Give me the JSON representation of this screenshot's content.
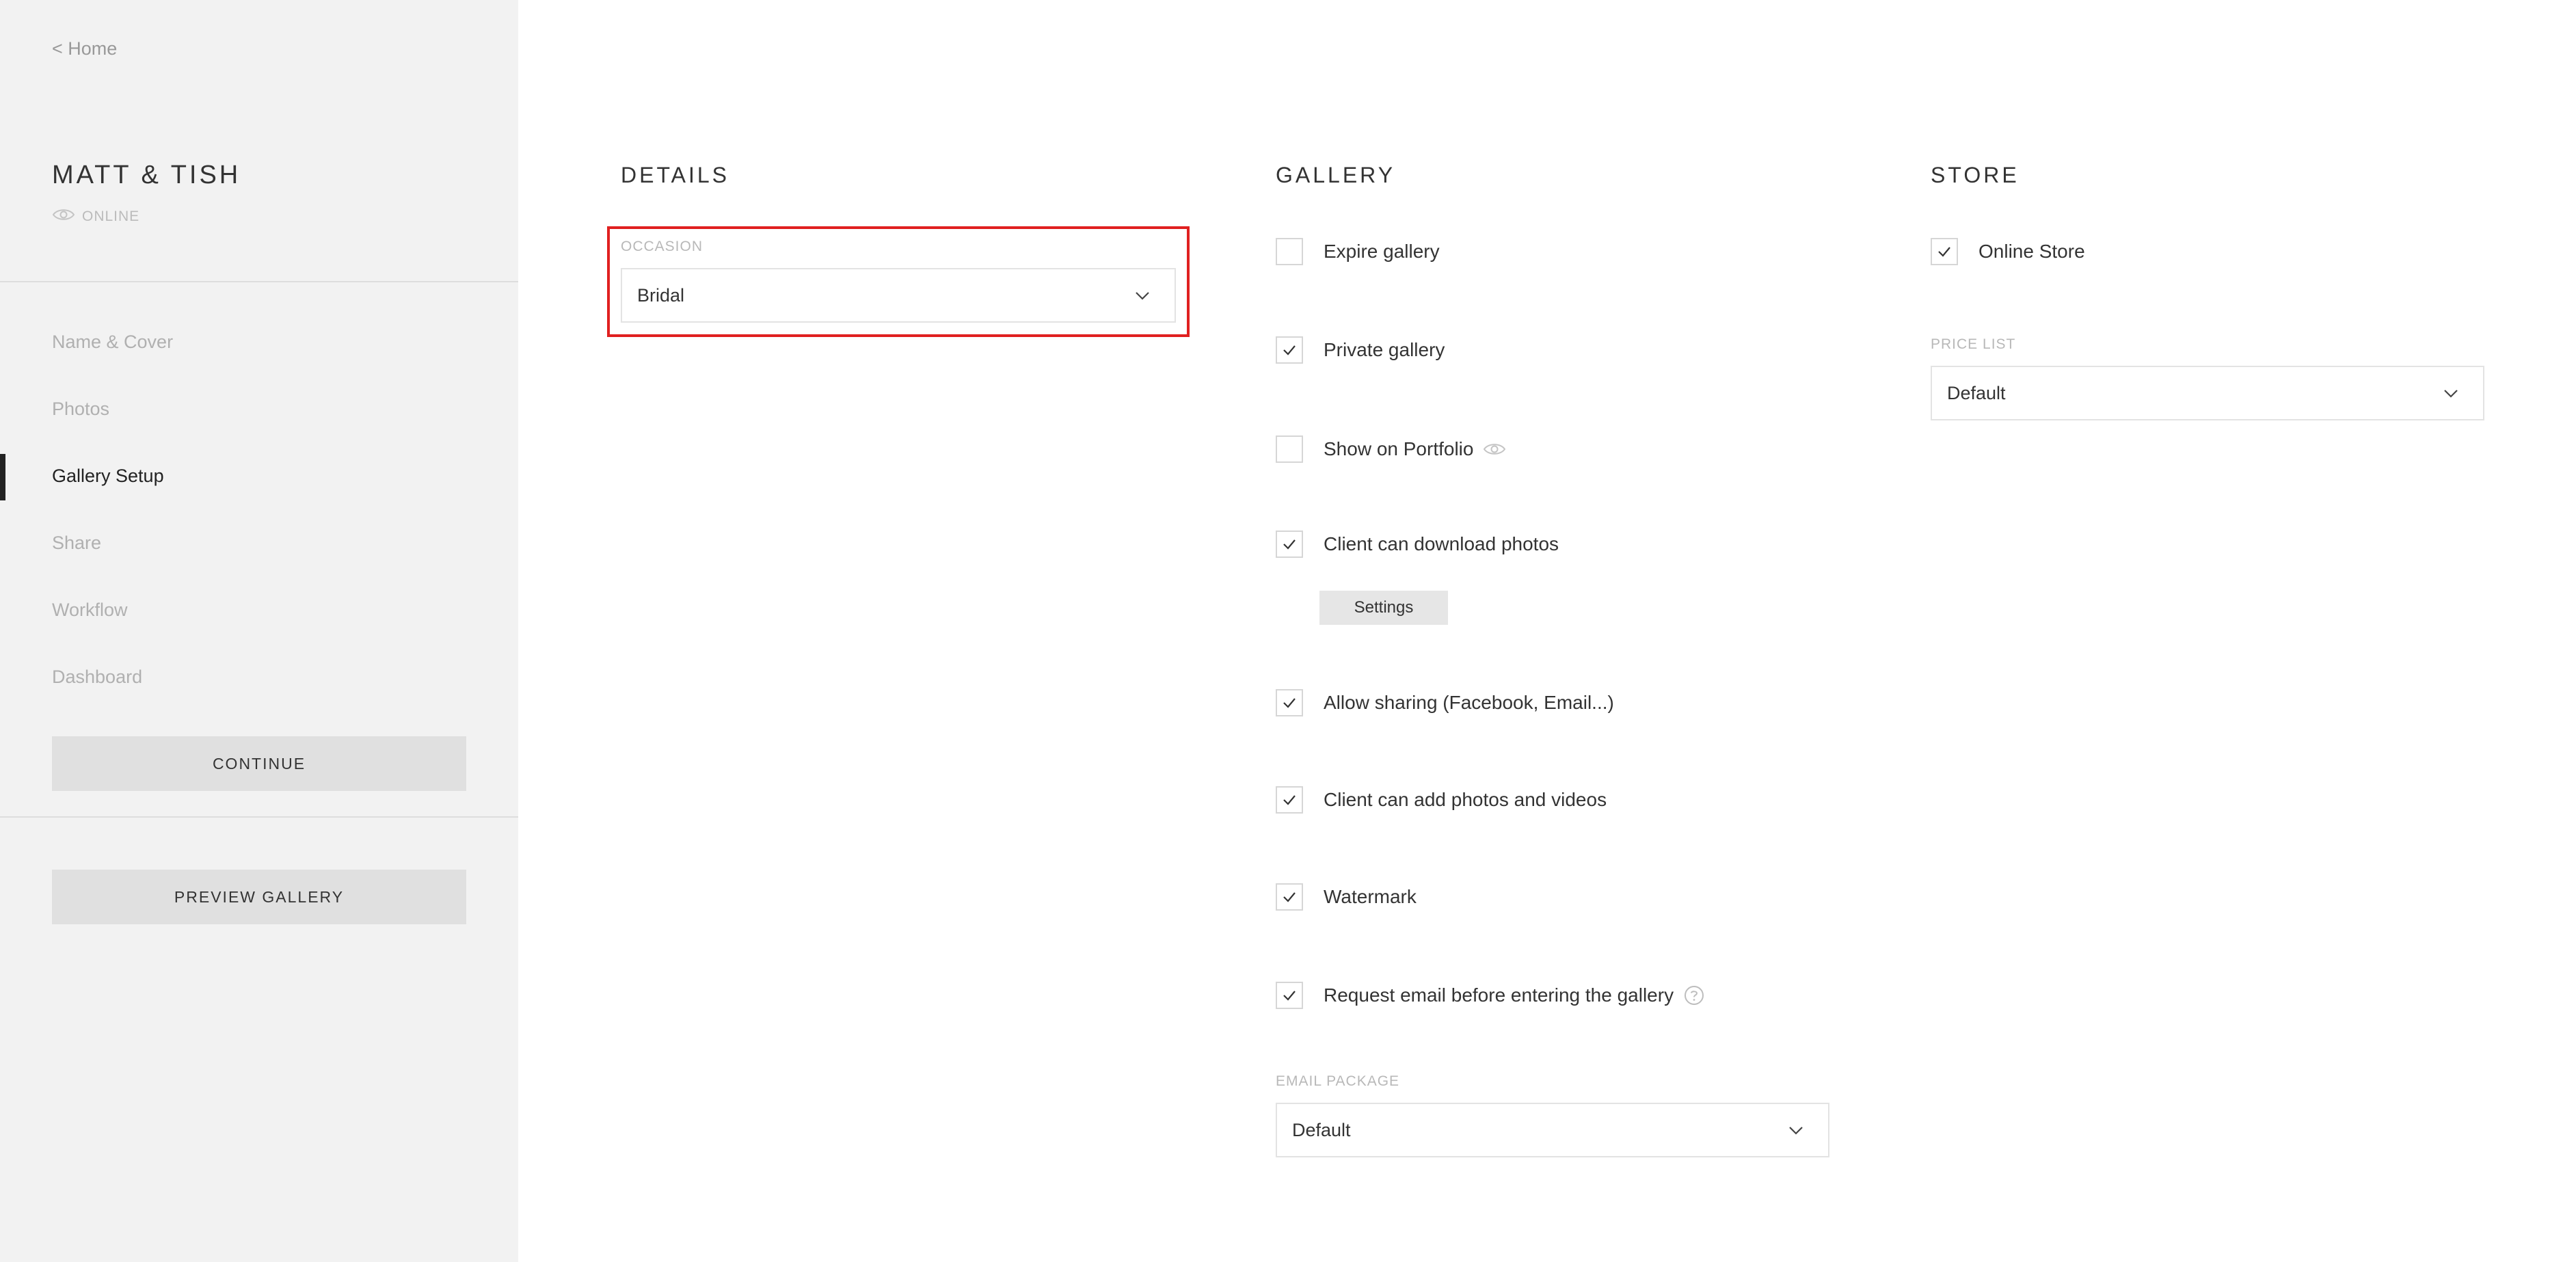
{
  "sidebar": {
    "home_link": "< Home",
    "gallery_title": "MATT & TISH",
    "status": "ONLINE",
    "nav": [
      "Name & Cover",
      "Photos",
      "Gallery Setup",
      "Share",
      "Workflow",
      "Dashboard"
    ],
    "active_nav": "Gallery Setup",
    "continue_label": "CONTINUE",
    "preview_label": "PREVIEW GALLERY"
  },
  "details": {
    "heading": "DETAILS",
    "occasion_label": "OCCASION",
    "occasion_value": "Bridal"
  },
  "gallery": {
    "heading": "GALLERY",
    "options": [
      {
        "label": "Expire gallery",
        "checked": false
      },
      {
        "label": "Private gallery",
        "checked": true
      },
      {
        "label": "Show on Portfolio",
        "checked": false,
        "icon": "eye-icon"
      },
      {
        "label": "Client can download photos",
        "checked": true
      },
      {
        "label": "Allow sharing (Facebook, Email...)",
        "checked": true
      },
      {
        "label": "Client can add photos and videos",
        "checked": true
      },
      {
        "label": "Watermark",
        "checked": true
      },
      {
        "label": "Request email before entering the gallery",
        "checked": true,
        "icon": "help-icon"
      }
    ],
    "settings_label": "Settings",
    "email_package_label": "EMAIL PACKAGE",
    "email_package_value": "Default"
  },
  "store": {
    "heading": "STORE",
    "online_store_label": "Online Store",
    "online_store_checked": true,
    "price_list_label": "PRICE LIST",
    "price_list_value": "Default"
  },
  "colors": {
    "sidebar_bg": "#f2f2f2",
    "highlight": "#e02020",
    "active_text": "#222222",
    "muted_text": "#b0b0b0"
  }
}
